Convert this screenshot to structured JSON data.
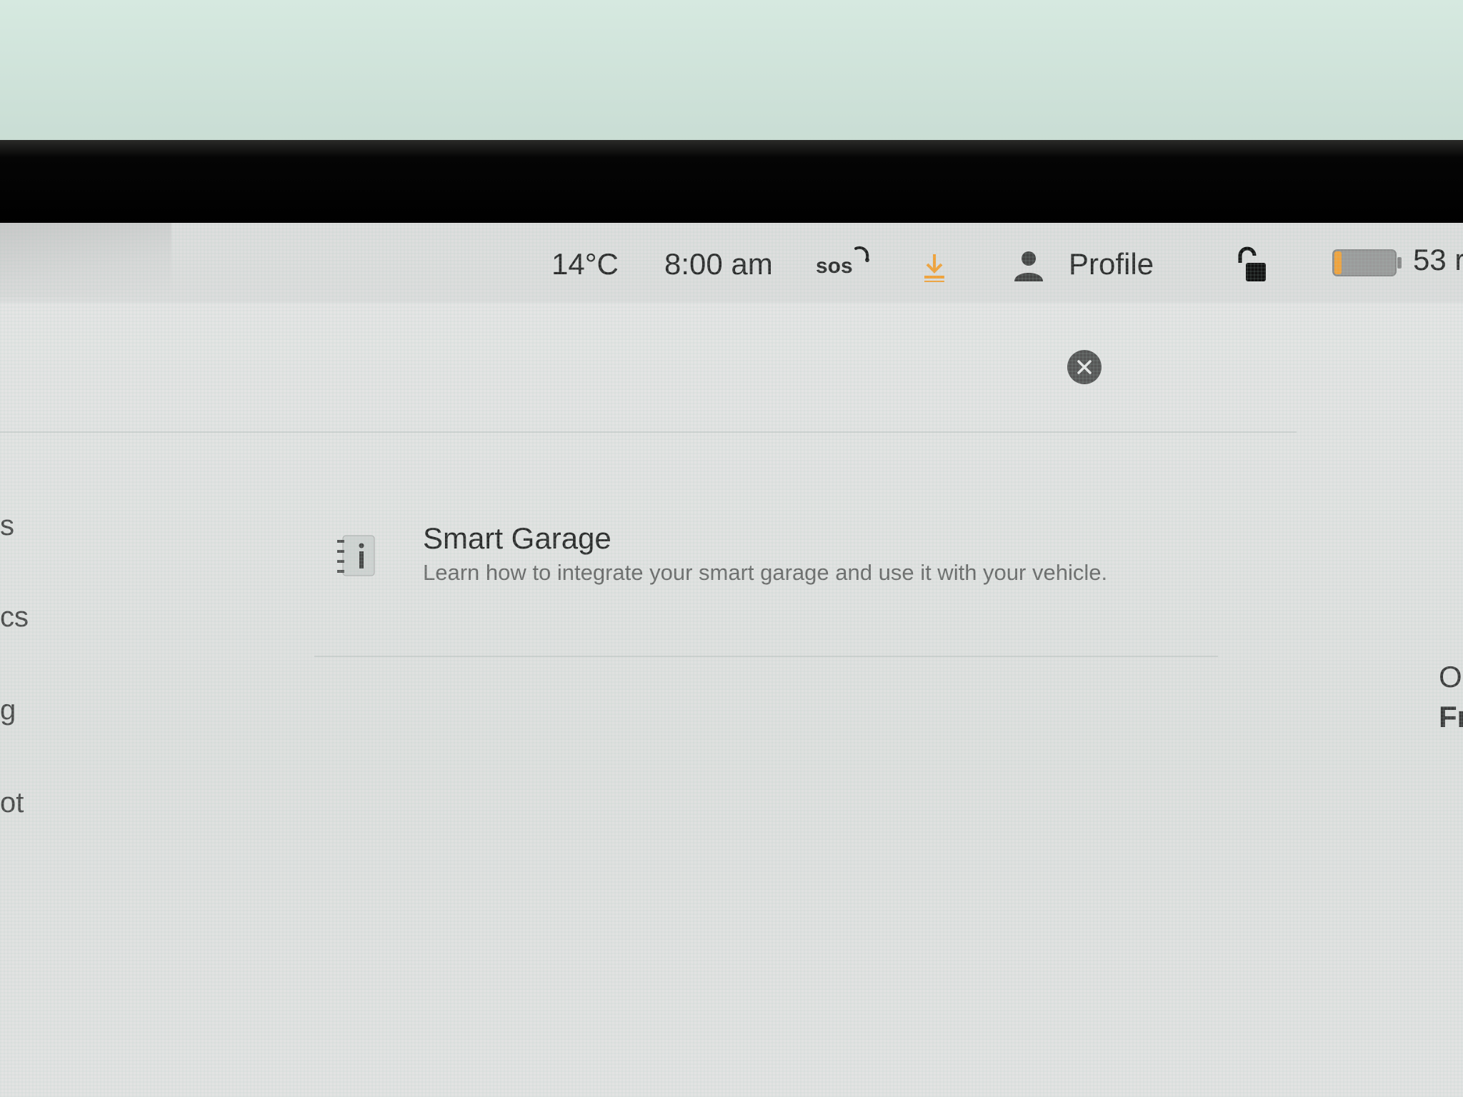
{
  "status_bar": {
    "temperature": "14°C",
    "time": "8:00 am",
    "sos_label": "sos",
    "profile_label": "Profile",
    "range": "53 r"
  },
  "sidebar": {
    "items": [
      {
        "label": "s"
      },
      {
        "label": "cs"
      },
      {
        "label": "g"
      },
      {
        "label": "ot"
      }
    ]
  },
  "main": {
    "row": {
      "title": "Smart Garage",
      "description": "Learn how to integrate your smart garage and use it with your vehicle."
    }
  },
  "right_panel": {
    "fragment_1": "O",
    "fragment_2": "Fr"
  },
  "colors": {
    "download_accent": "#f2a23a",
    "screen_bg": "#e3e3e3",
    "close_button": "#555555"
  }
}
